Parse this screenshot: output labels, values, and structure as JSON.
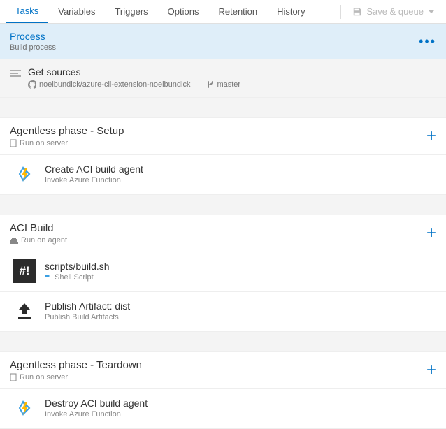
{
  "tabs": {
    "tasks": "Tasks",
    "variables": "Variables",
    "triggers": "Triggers",
    "options": "Options",
    "retention": "Retention",
    "history": "History"
  },
  "toolbar": {
    "save_queue": "Save & queue"
  },
  "process": {
    "title": "Process",
    "subtitle": "Build process"
  },
  "sources": {
    "title": "Get sources",
    "repo": "noelbundick/azure-cli-extension-noelbundick",
    "branch": "master"
  },
  "phases": [
    {
      "title": "Agentless phase - Setup",
      "runner": "Run on server",
      "tasks": [
        {
          "title": "Create ACI build agent",
          "subtitle": "Invoke Azure Function",
          "icon": "azure-function"
        }
      ]
    },
    {
      "title": "ACI Build",
      "runner": "Run on agent",
      "tasks": [
        {
          "title": "scripts/build.sh",
          "subtitle": "Shell Script",
          "icon": "shell",
          "flagged": true
        },
        {
          "title": "Publish Artifact: dist",
          "subtitle": "Publish Build Artifacts",
          "icon": "publish"
        }
      ]
    },
    {
      "title": "Agentless phase - Teardown",
      "runner": "Run on server",
      "tasks": [
        {
          "title": "Destroy ACI build agent",
          "subtitle": "Invoke Azure Function",
          "icon": "azure-function"
        }
      ]
    }
  ]
}
